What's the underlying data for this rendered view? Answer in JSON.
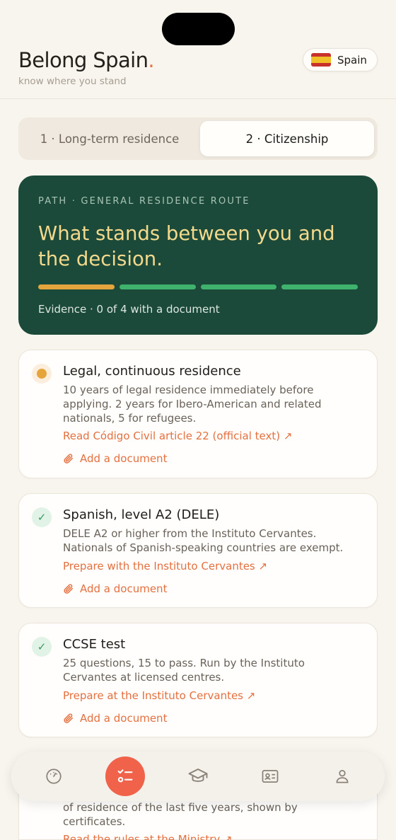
{
  "app": {
    "brand": "Belong Spain",
    "brand_dot": ".",
    "tagline": "know where you stand",
    "country": "Spain"
  },
  "segments": [
    {
      "label": "1 · Long-term residence",
      "active": false
    },
    {
      "label": "2 · Citizenship",
      "active": true
    }
  ],
  "hero": {
    "kicker": "PATH · GENERAL RESIDENCE ROUTE",
    "title": "What stands between you and the decision.",
    "progress": [
      "pending",
      "done",
      "done",
      "done"
    ],
    "evidence": "Evidence · 0 of 4 with a document"
  },
  "requirements": [
    {
      "status": "pending",
      "title": "Legal, continuous residence",
      "desc_lines": [
        "10 years of legal residence immediately before",
        "applying. 2 years for Ibero-American and related",
        "nationals, 5 for refugees."
      ],
      "link": "Read Código Civil article 22 (official text) ↗",
      "add": "Add a document"
    },
    {
      "status": "done",
      "title": "Spanish, level A2 (DELE)",
      "desc_lines": [
        "DELE A2 or higher from the Instituto Cervantes.",
        "Nationals of Spanish-speaking countries are exempt."
      ],
      "link": "Prepare with the Instituto Cervantes ↗",
      "add": "Add a document"
    },
    {
      "status": "done",
      "title": "CCSE test",
      "desc_lines": [
        "25 questions, 15 to pass. Run by the Instituto",
        "Cervantes at licensed centres."
      ],
      "link": "Prepare at the Instituto Cervantes ↗",
      "add": "Add a document"
    },
    {
      "partial_lines": [
        "of residence of the last five years, shown by",
        "certificates."
      ],
      "link": "Read the rules at the Ministry ↗"
    }
  ],
  "tabbar": [
    {
      "icon": "gauge-icon",
      "active": false
    },
    {
      "icon": "checklist-icon",
      "active": true
    },
    {
      "icon": "graduation-cap-icon",
      "active": false
    },
    {
      "icon": "id-card-icon",
      "active": false
    },
    {
      "icon": "user-icon",
      "active": false
    }
  ],
  "colors": {
    "background": "#f8f4ee",
    "hero": "#1c4a3a",
    "hero_title": "#f3d98c",
    "accent": "#e4703f",
    "pending": "#e6a43c",
    "done": "#3fb26d"
  }
}
